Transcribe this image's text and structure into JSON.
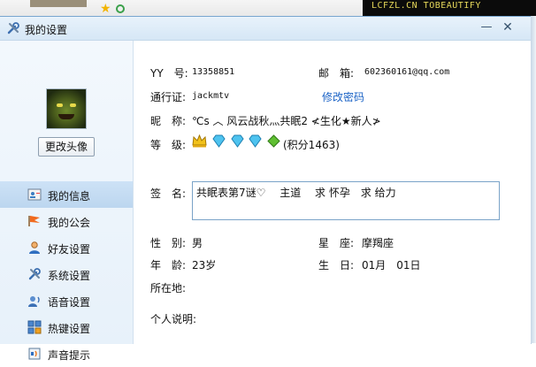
{
  "background": {
    "watermark": "LCFZL.CN TOBEAUTIFY"
  },
  "window": {
    "title": "我的设置",
    "minimize_glyph": "—",
    "close_glyph": "✕"
  },
  "sidebar": {
    "change_avatar_label": "更改头像",
    "items": [
      {
        "label": "我的信息",
        "icon": "id-card-icon",
        "active": true
      },
      {
        "label": "我的公会",
        "icon": "flag-icon",
        "active": false
      },
      {
        "label": "好友设置",
        "icon": "user-icon",
        "active": false
      },
      {
        "label": "系统设置",
        "icon": "tools-icon",
        "active": false
      },
      {
        "label": "语音设置",
        "icon": "voice-icon",
        "active": false
      },
      {
        "label": "热键设置",
        "icon": "keyboard-icon",
        "active": false
      },
      {
        "label": "声音提示",
        "icon": "sound-icon",
        "active": false
      }
    ]
  },
  "profile": {
    "yy_label": "YY　号:",
    "yy_value": "13358851",
    "email_label": "邮　箱:",
    "email_value": "602360161@qq.com",
    "passport_label": "通行证:",
    "passport_value": "jackmtv",
    "change_password": "修改密码",
    "nickname_label": "昵　称:",
    "nickname_value": "℃s ︿ 风云战秋灬共眠2 ≮生化★新人≯",
    "level_label": "等　级:",
    "points_text": "(积分1463)",
    "signature_label": "签　名:",
    "signature_value": "共眠表第7谜♡　 主道　 求 怀孕　求 给力",
    "gender_label": "性　别:",
    "gender_value": "男",
    "zodiac_label": "星　座:",
    "zodiac_value": "摩羯座",
    "age_label": "年　龄:",
    "age_value": "23岁",
    "birthday_label": "生　日:",
    "birthday_value": "01月　01日",
    "location_label": "所在地:",
    "bio_label": "个人说明:"
  },
  "colors": {
    "link": "#1b63c6",
    "active_item": "#c6ddf3",
    "sidebar_bg": "#eef5fc"
  }
}
